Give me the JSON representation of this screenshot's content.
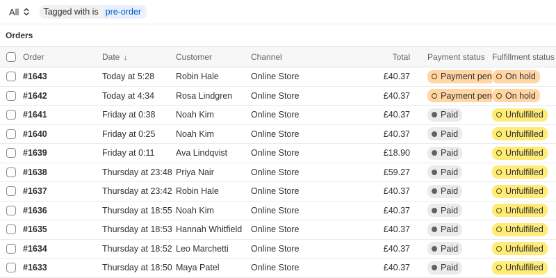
{
  "filters": {
    "view_select": "All",
    "chip_label": "Tagged with is",
    "chip_value": "pre-order"
  },
  "section_title": "Orders",
  "columns": {
    "order": "Order",
    "date": "Date",
    "date_sort": "↓",
    "customer": "Customer",
    "channel": "Channel",
    "total": "Total",
    "payment": "Payment status",
    "fulfillment": "Fulfillment status"
  },
  "status_styles": {
    "Payment pending": {
      "bg": "#ffd6a4",
      "dot": "ring"
    },
    "Paid": {
      "bg": "#ebebeb",
      "dot": "solid"
    },
    "On hold": {
      "bg": "#ffd6a4",
      "dot": "ring"
    },
    "Unfulfilled": {
      "bg": "#ffeb78",
      "dot": "ring-ful"
    }
  },
  "orders": [
    {
      "order": "#1643",
      "date": "Today at 5:28",
      "customer": "Robin Hale",
      "channel": "Online Store",
      "total": "£40.37",
      "payment": "Payment pending",
      "fulfillment": "On hold"
    },
    {
      "order": "#1642",
      "date": "Today at 4:34",
      "customer": "Rosa Lindgren",
      "channel": "Online Store",
      "total": "£40.37",
      "payment": "Payment pending",
      "fulfillment": "On hold"
    },
    {
      "order": "#1641",
      "date": "Friday at 0:38",
      "customer": "Noah Kim",
      "channel": "Online Store",
      "total": "£40.37",
      "payment": "Paid",
      "fulfillment": "Unfulfilled"
    },
    {
      "order": "#1640",
      "date": "Friday at 0:25",
      "customer": "Noah Kim",
      "channel": "Online Store",
      "total": "£40.37",
      "payment": "Paid",
      "fulfillment": "Unfulfilled"
    },
    {
      "order": "#1639",
      "date": "Friday at 0:11",
      "customer": "Ava Lindqvist",
      "channel": "Online Store",
      "total": "£18.90",
      "payment": "Paid",
      "fulfillment": "Unfulfilled"
    },
    {
      "order": "#1638",
      "date": "Thursday at 23:48",
      "customer": "Priya Nair",
      "channel": "Online Store",
      "total": "£59.27",
      "payment": "Paid",
      "fulfillment": "Unfulfilled"
    },
    {
      "order": "#1637",
      "date": "Thursday at 23:42",
      "customer": "Robin Hale",
      "channel": "Online Store",
      "total": "£40.37",
      "payment": "Paid",
      "fulfillment": "Unfulfilled"
    },
    {
      "order": "#1636",
      "date": "Thursday at 18:55",
      "customer": "Noah Kim",
      "channel": "Online Store",
      "total": "£40.37",
      "payment": "Paid",
      "fulfillment": "Unfulfilled"
    },
    {
      "order": "#1635",
      "date": "Thursday at 18:53",
      "customer": "Hannah Whitfield",
      "channel": "Online Store",
      "total": "£40.37",
      "payment": "Paid",
      "fulfillment": "Unfulfilled"
    },
    {
      "order": "#1634",
      "date": "Thursday at 18:52",
      "customer": "Leo Marchetti",
      "channel": "Online Store",
      "total": "£40.37",
      "payment": "Paid",
      "fulfillment": "Unfulfilled"
    },
    {
      "order": "#1633",
      "date": "Thursday at 18:50",
      "customer": "Maya Patel",
      "channel": "Online Store",
      "total": "£40.37",
      "payment": "Paid",
      "fulfillment": "Unfulfilled"
    }
  ]
}
